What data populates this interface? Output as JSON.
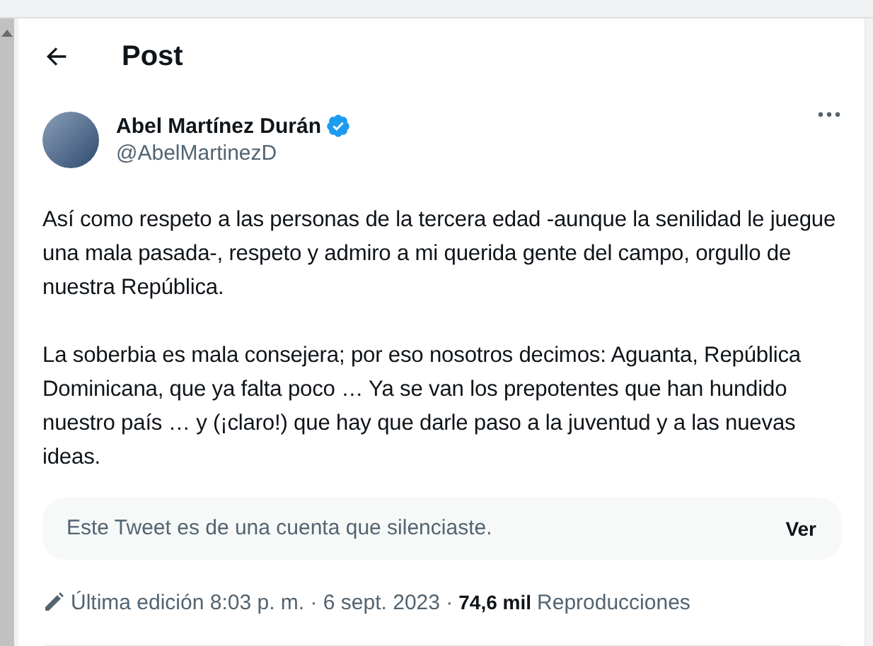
{
  "header": {
    "title": "Post"
  },
  "author": {
    "name": "Abel Martínez Durán",
    "handle": "@AbelMartinezD",
    "verified": true
  },
  "paragraphs": [
    "Así como respeto a las personas de la tercera edad -aunque la senilidad le juegue una mala pasada-, respeto y admiro a mi querida gente del campo, orgullo de nuestra República.",
    "La soberbia es mala consejera; por eso nosotros decimos: Aguanta, República Dominicana, que ya falta poco … Ya se van los prepotentes que han hundido nuestro país … y (¡claro!) que hay que darle paso a la juventud y a las nuevas ideas."
  ],
  "quoted_notice": {
    "text": "Este Tweet es de una cuenta que silenciaste.",
    "action": "Ver"
  },
  "meta": {
    "edited": "Última edición 8:03 p. m. · 6 sept. 2023 ·",
    "views_count": "74,6 mil",
    "views_label": "Reproducciones"
  }
}
